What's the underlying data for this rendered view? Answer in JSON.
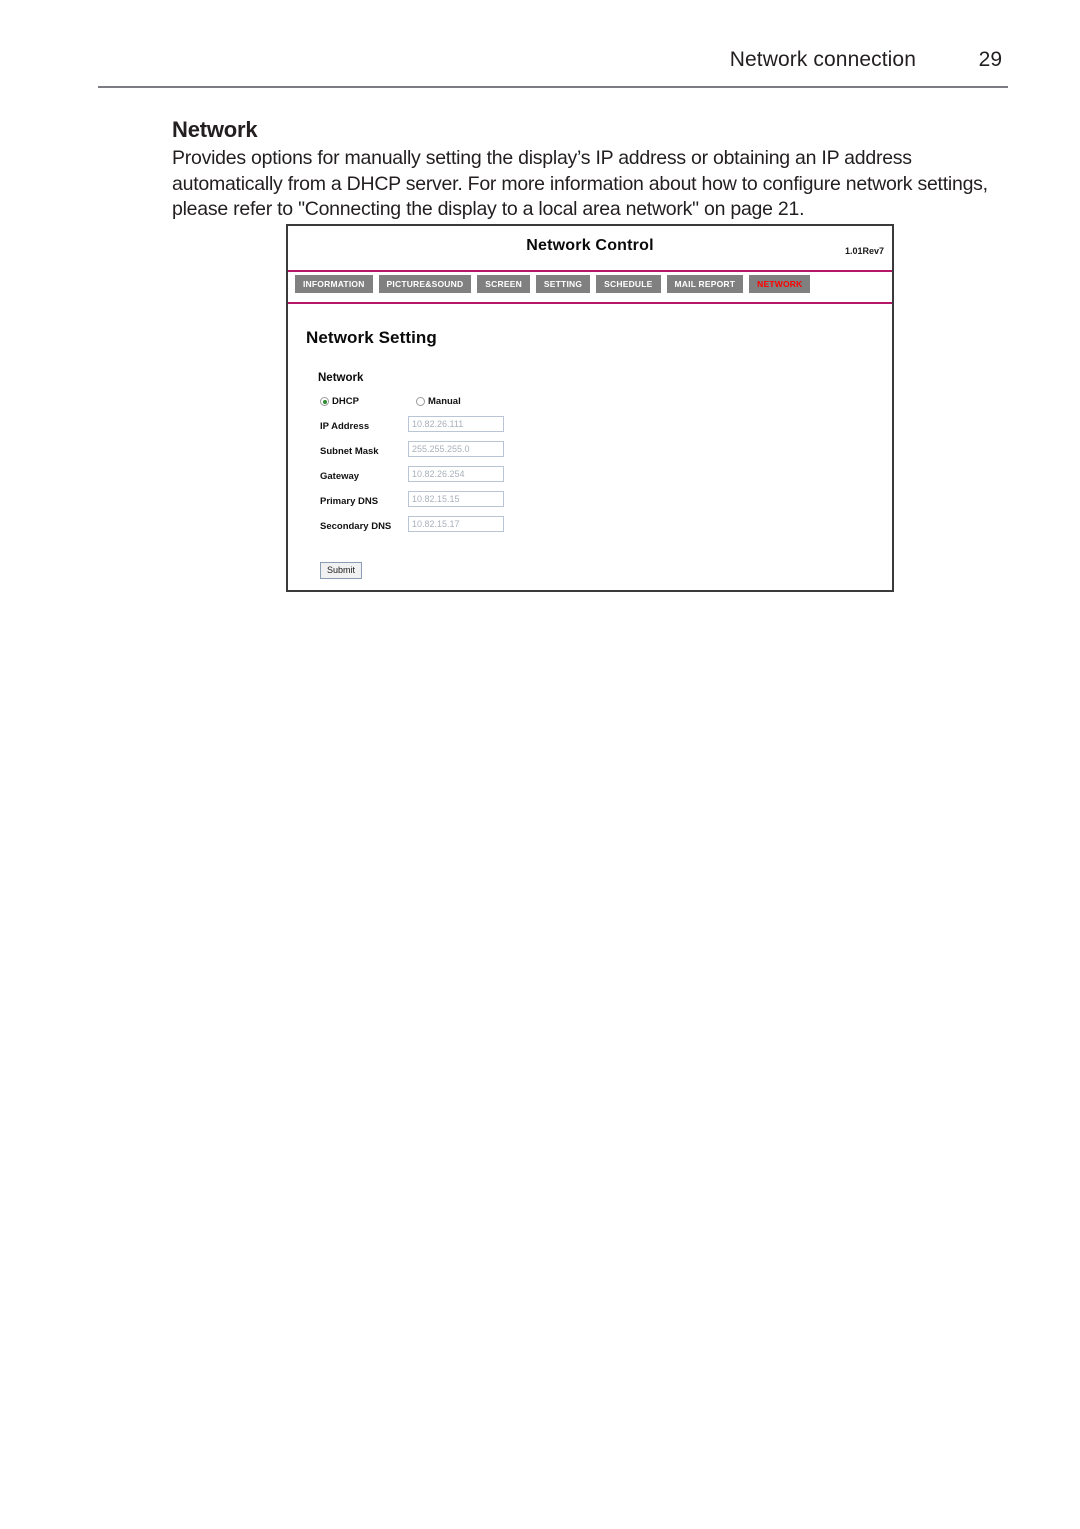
{
  "page_header": {
    "title": "Network connection",
    "page_number": "29"
  },
  "content": {
    "section_title": "Network",
    "paragraph": "Provides options for manually setting the display’s IP address or obtaining an IP address automatically from a DHCP server. For more information about how to configure network settings, please refer to \"Connecting the display to a local area network\" on page 21."
  },
  "device_screenshot": {
    "title": "Network Control",
    "version": "1.01Rev7",
    "tabs": [
      {
        "label": "INFORMATION",
        "active": false
      },
      {
        "label": "PICTURE&SOUND",
        "active": false
      },
      {
        "label": "SCREEN",
        "active": false
      },
      {
        "label": "SETTING",
        "active": false
      },
      {
        "label": "SCHEDULE",
        "active": false
      },
      {
        "label": "MAIL REPORT",
        "active": false
      },
      {
        "label": "NETWORK",
        "active": true
      }
    ],
    "heading": "Network Setting",
    "group_label": "Network",
    "mode_options": [
      {
        "label": "DHCP",
        "selected": true
      },
      {
        "label": "Manual",
        "selected": false
      }
    ],
    "fields": [
      {
        "label": "IP Address",
        "value": "10.82.26.111"
      },
      {
        "label": "Subnet Mask",
        "value": "255.255.255.0"
      },
      {
        "label": "Gateway",
        "value": "10.82.26.254"
      },
      {
        "label": "Primary DNS",
        "value": "10.82.15.15"
      },
      {
        "label": "Secondary DNS",
        "value": "10.82.15.17"
      }
    ],
    "submit_label": "Submit",
    "colors": {
      "rule": "#b5176b",
      "tab_background": "#808080",
      "active_tab_text": "#ff0000",
      "radio_selected": "#2e8b2e"
    }
  }
}
